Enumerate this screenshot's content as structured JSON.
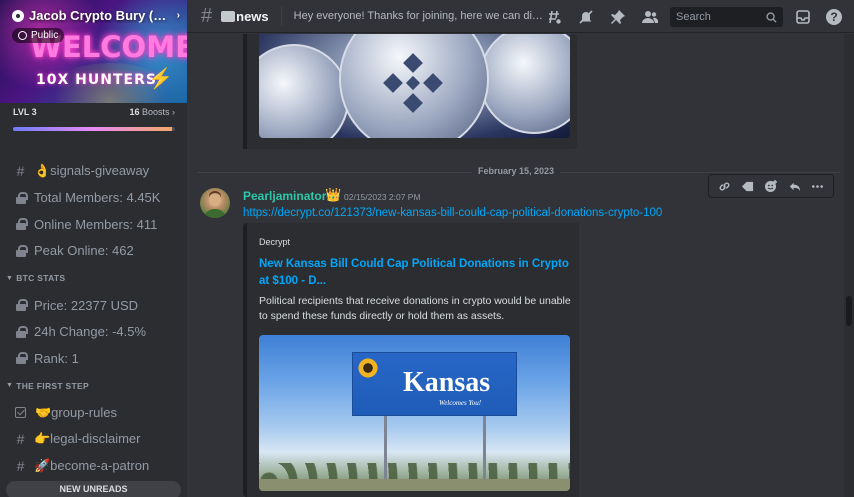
{
  "server": {
    "name": "Jacob Crypto Bury (W...",
    "visibility": "Public",
    "banner_title": "WELCOME",
    "banner_subtitle": "10X HUNTERS!",
    "level": "LVL 3",
    "boost_count": "16",
    "boost_label": "Boosts",
    "boost_progress": 0.98
  },
  "sidebar": {
    "channels_top": [
      {
        "icon": "hash-icon",
        "label": "👌signals-giveaway"
      },
      {
        "icon": "lock-icon",
        "label": "Total Members: 4.45K"
      },
      {
        "icon": "lock-icon",
        "label": "Online Members: 411"
      },
      {
        "icon": "lock-icon",
        "label": "Peak Online: 462"
      }
    ],
    "category_btc": "BTC STATS",
    "channels_btc": [
      {
        "icon": "lock-icon",
        "label": "Price: 22377 USD"
      },
      {
        "icon": "lock-icon",
        "label": "24h Change: -4.5%"
      },
      {
        "icon": "lock-icon",
        "label": "Rank: 1"
      }
    ],
    "category_first": "THE FIRST STEP",
    "channels_first": [
      {
        "icon": "rules-icon",
        "label": "🤝group-rules"
      },
      {
        "icon": "hash-icon",
        "label": "👉legal-disclaimer"
      },
      {
        "icon": "hash-icon",
        "label": "🚀become-a-patron"
      }
    ],
    "new_unreads": "NEW UNREADS"
  },
  "topbar": {
    "channel_name": "news",
    "topic": "Hey everyone! Thanks for joining, here we can discu...",
    "search_placeholder": "Search"
  },
  "chat": {
    "date_divider": "February 15, 2023",
    "message": {
      "author": "Pearljaminator",
      "author_color": "#2dc7a9",
      "badge": "👑",
      "timestamp": "02/15/2023 2:07 PM",
      "link": "https://decrypt.co/121373/new-kansas-bill-could-cap-political-donations-crypto-100"
    },
    "embed": {
      "provider": "Decrypt",
      "title": "New Kansas Bill Could Cap Political Donations in Crypto at $100 - D...",
      "description": "Political recipients that receive donations in crypto would be unable to spend these funds directly or hold them as assets.",
      "image_sign_text": "Kansas",
      "image_sign_subtext": "Welcomes You!"
    }
  },
  "colors": {
    "accent_link": "#00a8fc",
    "background": "#313338",
    "sidebar": "#2b2d31"
  }
}
